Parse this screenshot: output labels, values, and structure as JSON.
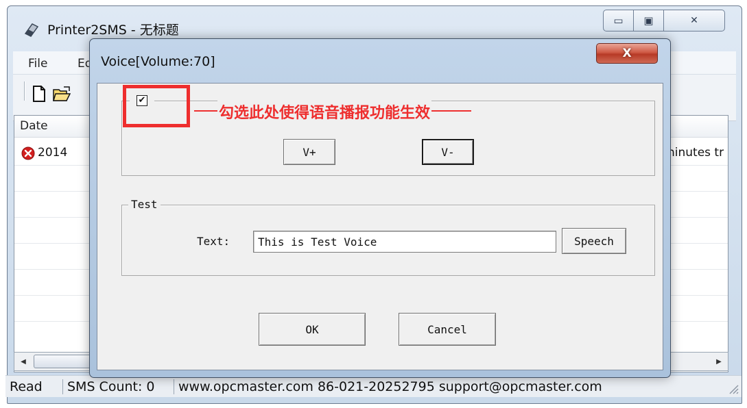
{
  "main_window": {
    "title": "Printer2SMS - 无标题",
    "controls": {
      "minimize": "▭",
      "maximize": "▣",
      "close": "✕"
    },
    "menu": {
      "file": "File",
      "edit_partial": "Ed"
    },
    "list": {
      "column_date": "Date",
      "rows": [
        {
          "status_icon": "error-icon",
          "date_partial": "2014",
          "message_partial": "ninutes tr"
        }
      ]
    },
    "status": {
      "ready_partial": "Read",
      "sms_count": "SMS Count: 0",
      "contact": "www.opcmaster.com 86-021-20252795 support@opcmaster.com"
    }
  },
  "dialog": {
    "title": "Voice[Volume:70]",
    "close_symbol": "X",
    "voice_enabled": true,
    "annotation": "勾选此处使得语音播报功能生效",
    "buttons": {
      "v_plus": "V+",
      "v_minus": "V-",
      "speech": "Speech",
      "ok": "OK",
      "cancel": "Cancel"
    },
    "test_group": {
      "legend": "Test",
      "text_label": "Text:",
      "text_value": "This is Test Voice"
    }
  },
  "colors": {
    "annotation": "#ee2e2e",
    "close_button": "#c94a36",
    "error_icon": "#d21f1f"
  }
}
